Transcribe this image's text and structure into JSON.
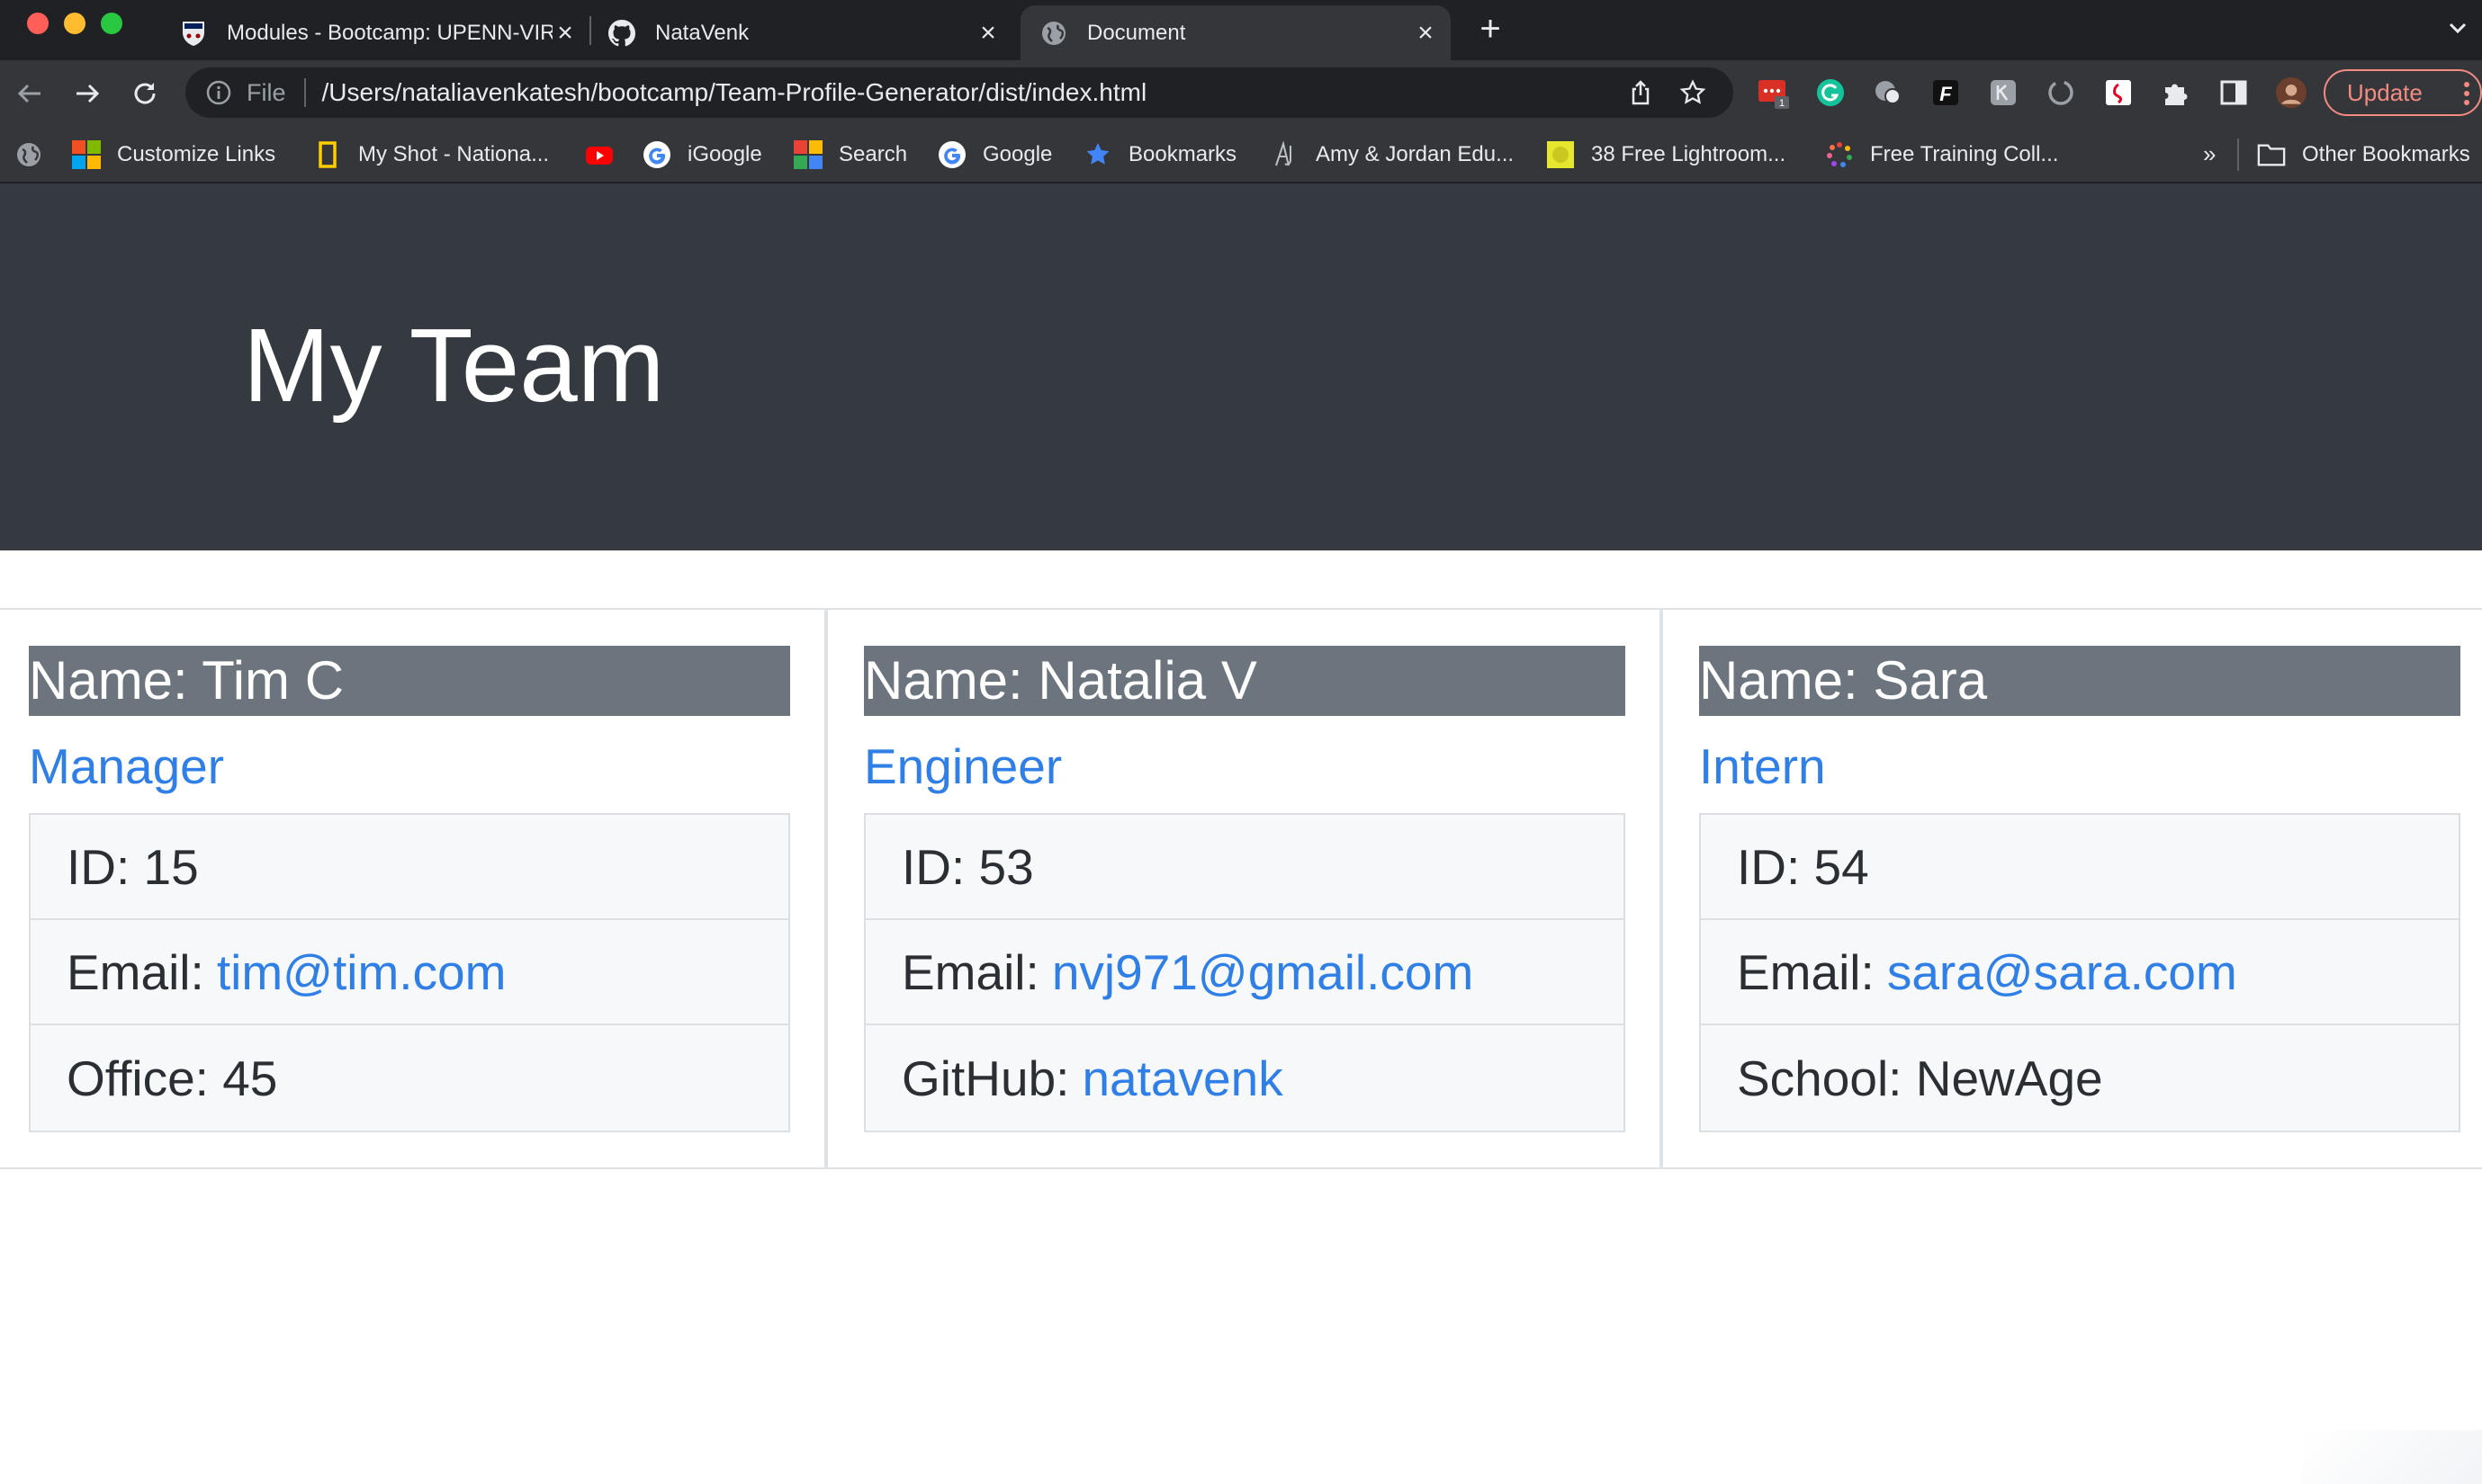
{
  "tabs": [
    {
      "title": "Modules - Bootcamp: UPENN-VIRT",
      "icon": "penn-shield-icon",
      "active": false
    },
    {
      "title": "NataVenk",
      "icon": "github-icon",
      "active": false
    },
    {
      "title": "Document",
      "icon": "globe-icon",
      "active": true
    }
  ],
  "omnibox": {
    "scheme": "File",
    "url": "/Users/nataliavenkatesh/bootcamp/Team-Profile-Generator/dist/index.html"
  },
  "extensions": [
    {
      "name": "todoist-extension-icon",
      "badge": "1",
      "color": "#d93025"
    },
    {
      "name": "grammarly-extension-icon",
      "color": "#15c39a"
    },
    {
      "name": "evernote-extension-icon",
      "color": "#9aa0a6"
    },
    {
      "name": "f-extension-icon",
      "color": "#ffffff"
    },
    {
      "name": "gray-extension-icon",
      "color": "#9aa0a6"
    },
    {
      "name": "loop-extension-icon",
      "color": "#9aa0a6"
    },
    {
      "name": "pinterest-extension-icon",
      "color": "#e60023"
    }
  ],
  "update_label": "Update",
  "bookmarks": [
    {
      "label": "Customize Links",
      "icon": "microsoft-logo-icon"
    },
    {
      "label": "My Shot - Nationa...",
      "icon": "natgeo-icon"
    },
    {
      "label": "",
      "icon": "youtube-icon"
    },
    {
      "label": "iGoogle",
      "icon": "google-icon"
    },
    {
      "label": "Search",
      "icon": "search-app-icon"
    },
    {
      "label": "Google",
      "icon": "google-icon"
    },
    {
      "label": "Bookmarks",
      "icon": "star-bookmark-icon"
    },
    {
      "label": "Amy & Jordan Edu...",
      "icon": "aj-icon"
    },
    {
      "label": "38 Free Lightroom...",
      "icon": "lightroom-icon"
    },
    {
      "label": "Free Training Coll...",
      "icon": "training-icon"
    }
  ],
  "bookmarks_more": "»",
  "other_bookmarks": "Other Bookmarks",
  "page": {
    "heading": "My Team",
    "members": [
      {
        "name": "Name: Tim C",
        "role": "Manager",
        "id": "ID: 15",
        "email_label": "Email:",
        "email": "tim@tim.com",
        "extra_label": "Office: 45",
        "extra_link": ""
      },
      {
        "name": "Name: Natalia V",
        "role": "Engineer",
        "id": "ID: 53",
        "email_label": "Email:",
        "email": "nvj971@gmail.com",
        "extra_label": "GitHub:",
        "extra_link": "natavenk"
      },
      {
        "name": "Name: Sara",
        "role": "Intern",
        "id": "ID: 54",
        "email_label": "Email:",
        "email": "sara@sara.com",
        "extra_label": "School: NewAge",
        "extra_link": ""
      }
    ]
  },
  "colors": {
    "jumbotron": "#343a40",
    "card_header": "#6c757d",
    "link": "#2f7fe6"
  }
}
